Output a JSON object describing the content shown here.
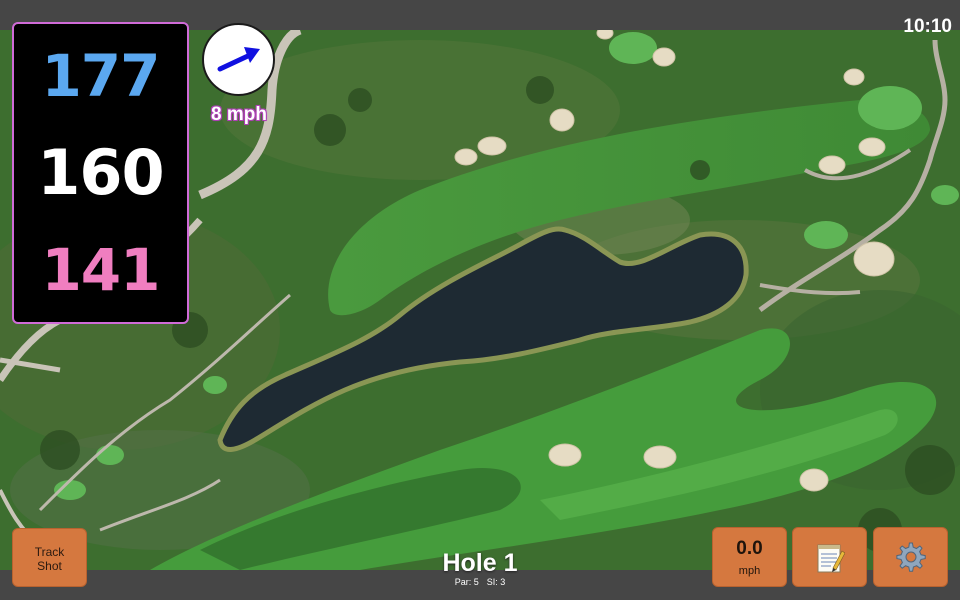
{
  "status_bar": {
    "time": "10:10"
  },
  "distances": {
    "back": "177",
    "middle": "160",
    "front": "141"
  },
  "wind": {
    "speed": "8 mph",
    "icon": "wind-arrow-icon",
    "arrow_color": "#1010e0"
  },
  "speedometer": {
    "value": "0.0",
    "unit": "mph"
  },
  "buttons": {
    "track_shot": "Track Shot",
    "notes_icon": "notepad-icon",
    "settings_icon": "gear-icon"
  },
  "hole": {
    "title": "Hole 1",
    "par": "Par: 5",
    "si": "SI: 3"
  },
  "colors": {
    "back_distance": "#5ba8f0",
    "middle_distance": "#ffffff",
    "front_distance": "#f07ec0",
    "panel_border": "#d06bd8",
    "button": "#d5783f"
  }
}
